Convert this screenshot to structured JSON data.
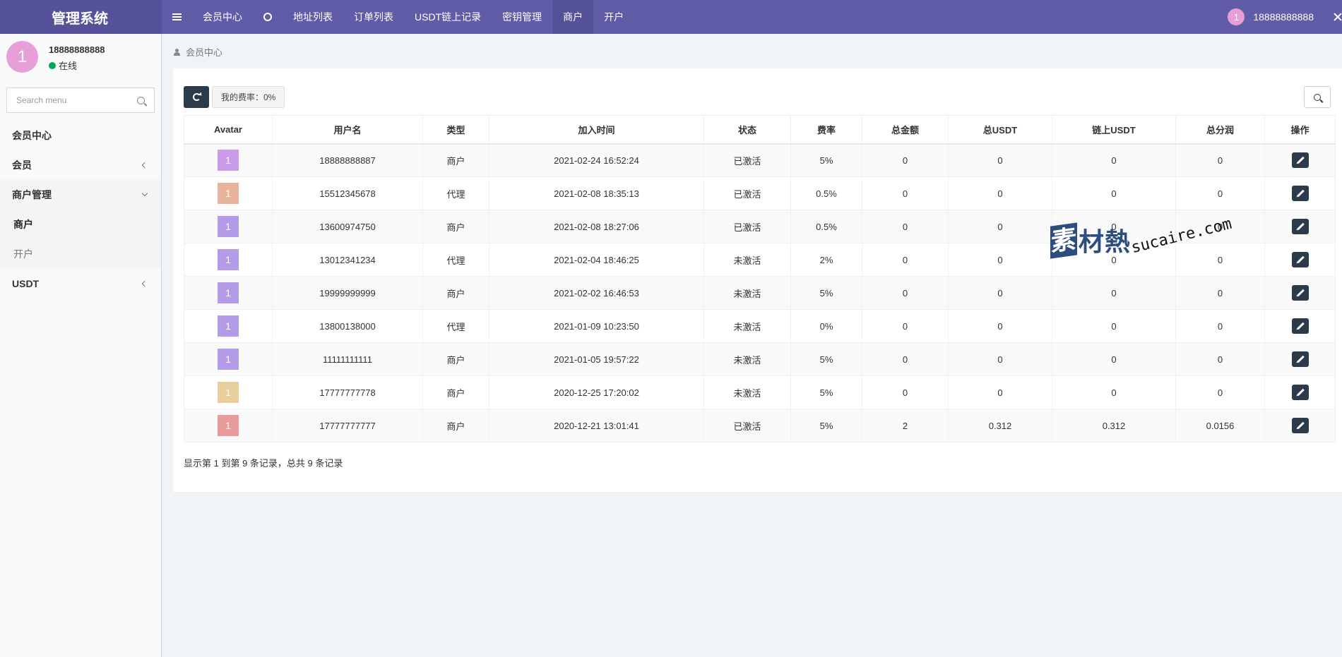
{
  "brand": "管理系统",
  "nav": {
    "items": [
      {
        "label": "会员中心"
      },
      {
        "label": "地址列表"
      },
      {
        "label": "订单列表"
      },
      {
        "label": "USDT链上记录"
      },
      {
        "label": "密钥管理"
      },
      {
        "label": "商户"
      },
      {
        "label": "开户"
      }
    ],
    "active": "商户"
  },
  "top_user": {
    "avatar": "1",
    "name": "18888888888"
  },
  "sidebar": {
    "avatar": "1",
    "username": "18888888888",
    "status": "在线",
    "search_placeholder": "Search menu",
    "menu": {
      "member_center": "会员中心",
      "member": "会员",
      "merchant_mgmt": "商户管理",
      "merchant": "商户",
      "open_account": "开户",
      "usdt": "USDT"
    }
  },
  "breadcrumb": "会员中心",
  "toolbar": {
    "rate_label": "我的费率：0%"
  },
  "table": {
    "columns": [
      "Avatar",
      "用户名",
      "类型",
      "加入时间",
      "状态",
      "费率",
      "总金额",
      "总USDT",
      "链上USDT",
      "总分润",
      "操作"
    ],
    "rows": [
      {
        "avatar": "1",
        "avatar_color": "#c99be8",
        "username": "18888888887",
        "type": "商户",
        "joined": "2021-02-24 16:52:24",
        "status": "已激活",
        "rate": "5%",
        "total_amount": "0",
        "total_usdt": "0",
        "chain_usdt": "0",
        "total_profit": "0"
      },
      {
        "avatar": "1",
        "avatar_color": "#e8b49b",
        "username": "15512345678",
        "type": "代理",
        "joined": "2021-02-08 18:35:13",
        "status": "已激活",
        "rate": "0.5%",
        "total_amount": "0",
        "total_usdt": "0",
        "chain_usdt": "0",
        "total_profit": "0"
      },
      {
        "avatar": "1",
        "avatar_color": "#b49be8",
        "username": "13600974750",
        "type": "商户",
        "joined": "2021-02-08 18:27:06",
        "status": "已激活",
        "rate": "0.5%",
        "total_amount": "0",
        "total_usdt": "0",
        "chain_usdt": "0",
        "total_profit": "0"
      },
      {
        "avatar": "1",
        "avatar_color": "#b49be8",
        "username": "13012341234",
        "type": "代理",
        "joined": "2021-02-04 18:46:25",
        "status": "未激活",
        "rate": "2%",
        "total_amount": "0",
        "total_usdt": "0",
        "chain_usdt": "0",
        "total_profit": "0"
      },
      {
        "avatar": "1",
        "avatar_color": "#b49be8",
        "username": "19999999999",
        "type": "商户",
        "joined": "2021-02-02 16:46:53",
        "status": "未激活",
        "rate": "5%",
        "total_amount": "0",
        "total_usdt": "0",
        "chain_usdt": "0",
        "total_profit": "0"
      },
      {
        "avatar": "1",
        "avatar_color": "#b49be8",
        "username": "13800138000",
        "type": "代理",
        "joined": "2021-01-09 10:23:50",
        "status": "未激活",
        "rate": "0%",
        "total_amount": "0",
        "total_usdt": "0",
        "chain_usdt": "0",
        "total_profit": "0"
      },
      {
        "avatar": "1",
        "avatar_color": "#b49be8",
        "username": "11111111111",
        "type": "商户",
        "joined": "2021-01-05 19:57:22",
        "status": "未激活",
        "rate": "5%",
        "total_amount": "0",
        "total_usdt": "0",
        "chain_usdt": "0",
        "total_profit": "0"
      },
      {
        "avatar": "1",
        "avatar_color": "#e8cf9b",
        "username": "17777777778",
        "type": "商户",
        "joined": "2020-12-25 17:20:02",
        "status": "未激活",
        "rate": "5%",
        "total_amount": "0",
        "total_usdt": "0",
        "chain_usdt": "0",
        "total_profit": "0"
      },
      {
        "avatar": "1",
        "avatar_color": "#e89b9b",
        "username": "17777777777",
        "type": "商户",
        "joined": "2020-12-21 13:01:41",
        "status": "已激活",
        "rate": "5%",
        "total_amount": "2",
        "total_usdt": "0.312",
        "chain_usdt": "0.312",
        "total_profit": "0.0156"
      }
    ]
  },
  "pagination_info": "显示第 1 到第 9 条记录，总共 9 条记录",
  "watermark": {
    "mark": "素",
    "text": "材熱",
    "url": "sucaire.com"
  }
}
